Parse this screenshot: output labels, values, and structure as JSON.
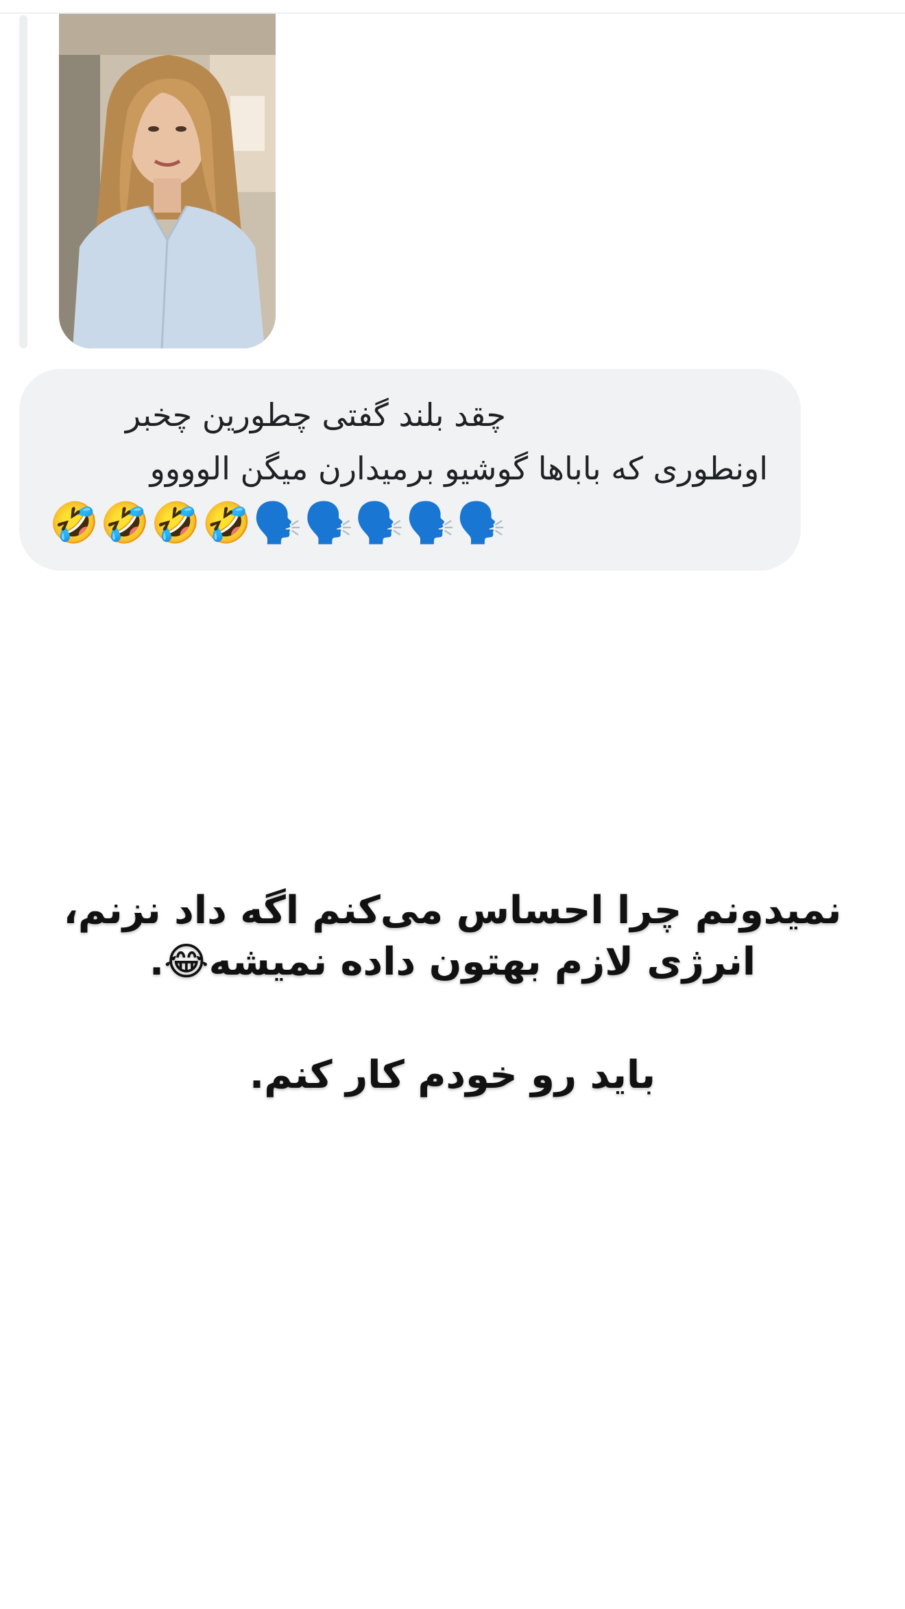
{
  "reply_media": {
    "type": "photo",
    "description_icon": "portrait-photo"
  },
  "chat_bubble": {
    "line1": "چقد بلند گفتی چطورین چخبر",
    "line2": "اونطوری که باباها گوشیو برمیدارن میگن الوووو",
    "line3": "🤣🤣🤣🤣🗣️🗣️🗣️🗣️🗣️"
  },
  "caption": {
    "line1": "نمیدونم چرا احساس می‌کنم اگه داد نزنم،",
    "line2": "انرژی لازم بهتون داده نمیشه😂.",
    "line3": "باید رو خودم کار کنم."
  },
  "colors": {
    "bubble_bg": "#f1f2f4",
    "reply_bar": "#eceef0",
    "text": "#1f2225",
    "caption_text": "#111111"
  }
}
